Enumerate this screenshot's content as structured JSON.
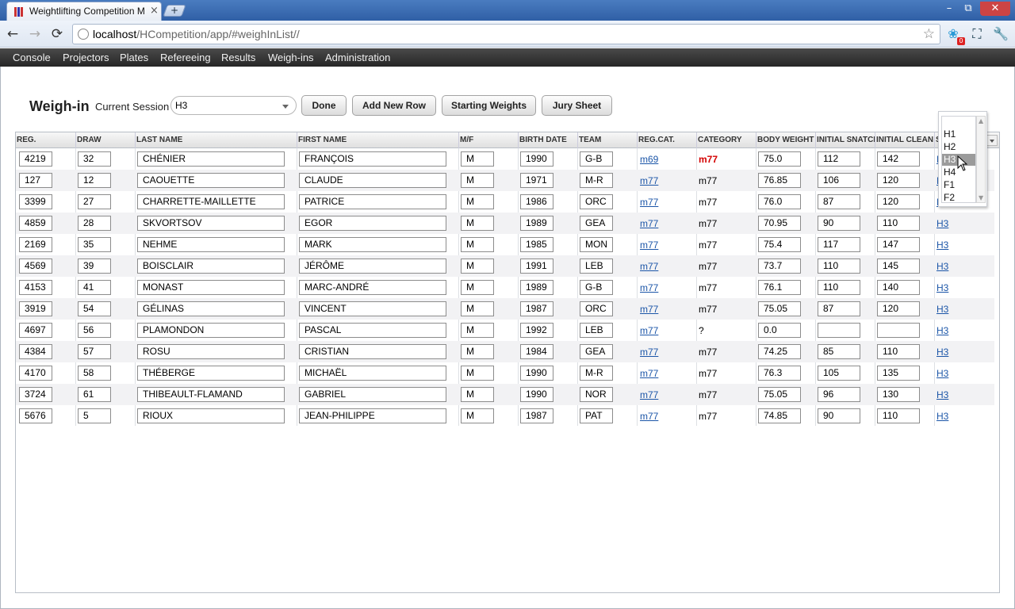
{
  "browser": {
    "tab_title": "Weightlifting Competition M...",
    "tab_close": "×",
    "new_tab": "+",
    "win_min": "–",
    "win_max": "⧉",
    "win_close": "✕",
    "back": "←",
    "forward": "→",
    "reload": "⟳",
    "url_host": "localhost",
    "url_path": "/HCompetition/app/#weighInList//",
    "star": "☆",
    "ext_badge": "0",
    "ext_icon1": "❀",
    "ext_icon2": "⛶",
    "ext_icon3": "🔧"
  },
  "menu": [
    "Console",
    "Projectors",
    "Plates",
    "Refereeing",
    "Results",
    "Weigh-ins",
    "Administration"
  ],
  "header": {
    "title": "Weigh-in",
    "session_label": "Current Session",
    "session_value": "H3",
    "buttons": [
      "Done",
      "Add New Row",
      "Starting Weights",
      "Jury Sheet"
    ]
  },
  "columns": [
    "REG.",
    "DRAW",
    "LAST NAME",
    "FIRST NAME",
    "M/F",
    "BIRTH DATE",
    "TEAM",
    "REG.CAT.",
    "CATEGORY",
    "BODY WEIGHT",
    "INITIAL SNATCH",
    "INITIAL CLEAN",
    "S"
  ],
  "rows": [
    {
      "reg": "4219",
      "draw": "32",
      "last": "CHÉNIER",
      "first": "FRANÇOIS",
      "mf": "M",
      "birth": "1990",
      "team": "G-B",
      "regcat": "m69",
      "category": "m77",
      "bw": "75.0",
      "snatch": "112",
      "clean": "142",
      "session": "H3",
      "warn": true
    },
    {
      "reg": "127",
      "draw": "12",
      "last": "CAOUETTE",
      "first": "CLAUDE",
      "mf": "M",
      "birth": "1971",
      "team": "M-R",
      "regcat": "m77",
      "category": "m77",
      "bw": "76.85",
      "snatch": "106",
      "clean": "120",
      "session": "H3"
    },
    {
      "reg": "3399",
      "draw": "27",
      "last": "CHARRETTE-MAILLETTE",
      "first": "PATRICE",
      "mf": "M",
      "birth": "1986",
      "team": "ORC",
      "regcat": "m77",
      "category": "m77",
      "bw": "76.0",
      "snatch": "87",
      "clean": "120",
      "session": "H3"
    },
    {
      "reg": "4859",
      "draw": "28",
      "last": "SKVORTSOV",
      "first": "EGOR",
      "mf": "M",
      "birth": "1989",
      "team": "GEA",
      "regcat": "m77",
      "category": "m77",
      "bw": "70.95",
      "snatch": "90",
      "clean": "110",
      "session": "H3"
    },
    {
      "reg": "2169",
      "draw": "35",
      "last": "NEHME",
      "first": "MARK",
      "mf": "M",
      "birth": "1985",
      "team": "MON",
      "regcat": "m77",
      "category": "m77",
      "bw": "75.4",
      "snatch": "117",
      "clean": "147",
      "session": "H3"
    },
    {
      "reg": "4569",
      "draw": "39",
      "last": "BOISCLAIR",
      "first": "JÉRÔME",
      "mf": "M",
      "birth": "1991",
      "team": "LEB",
      "regcat": "m77",
      "category": "m77",
      "bw": "73.7",
      "snatch": "110",
      "clean": "145",
      "session": "H3"
    },
    {
      "reg": "4153",
      "draw": "41",
      "last": "MONAST",
      "first": "MARC-ANDRÉ",
      "mf": "M",
      "birth": "1989",
      "team": "G-B",
      "regcat": "m77",
      "category": "m77",
      "bw": "76.1",
      "snatch": "110",
      "clean": "140",
      "session": "H3"
    },
    {
      "reg": "3919",
      "draw": "54",
      "last": "GÉLINAS",
      "first": "VINCENT",
      "mf": "M",
      "birth": "1987",
      "team": "ORC",
      "regcat": "m77",
      "category": "m77",
      "bw": "75.05",
      "snatch": "87",
      "clean": "120",
      "session": "H3"
    },
    {
      "reg": "4697",
      "draw": "56",
      "last": "PLAMONDON",
      "first": "PASCAL",
      "mf": "M",
      "birth": "1992",
      "team": "LEB",
      "regcat": "m77",
      "category": "?",
      "bw": "0.0",
      "snatch": "",
      "clean": "",
      "session": "H3"
    },
    {
      "reg": "4384",
      "draw": "57",
      "last": "ROSU",
      "first": "CRISTIAN",
      "mf": "M",
      "birth": "1984",
      "team": "GEA",
      "regcat": "m77",
      "category": "m77",
      "bw": "74.25",
      "snatch": "85",
      "clean": "110",
      "session": "H3"
    },
    {
      "reg": "4170",
      "draw": "58",
      "last": "THÉBERGE",
      "first": "MICHAËL",
      "mf": "M",
      "birth": "1990",
      "team": "M-R",
      "regcat": "m77",
      "category": "m77",
      "bw": "76.3",
      "snatch": "105",
      "clean": "135",
      "session": "H3"
    },
    {
      "reg": "3724",
      "draw": "61",
      "last": "THIBEAULT-FLAMAND",
      "first": "GABRIEL",
      "mf": "M",
      "birth": "1990",
      "team": "NOR",
      "regcat": "m77",
      "category": "m77",
      "bw": "75.05",
      "snatch": "96",
      "clean": "130",
      "session": "H3"
    },
    {
      "reg": "5676",
      "draw": "5",
      "last": "RIOUX",
      "first": "JEAN-PHILIPPE",
      "mf": "M",
      "birth": "1987",
      "team": "PAT",
      "regcat": "m77",
      "category": "m77",
      "bw": "74.85",
      "snatch": "90",
      "clean": "110",
      "session": "H3"
    }
  ],
  "popup": {
    "options": [
      "H1",
      "H2",
      "H3",
      "H4",
      "F1",
      "F2"
    ],
    "selected": "H3",
    "scroll_up": "▲",
    "scroll_down": "▼"
  },
  "colors": {
    "menubar": "#2f2f2f",
    "link": "#1c56a8",
    "warn": "#d40000"
  }
}
